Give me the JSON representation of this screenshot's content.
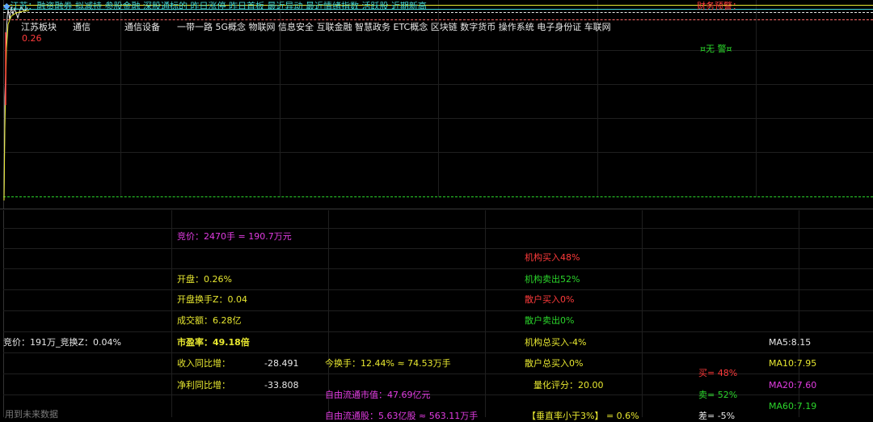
{
  "colors": {
    "cyan": "#3fd1d1",
    "red": "#ff3b3b",
    "green": "#2bd62b",
    "yellow": "#e8e830",
    "magenta": "#e23ce2",
    "white": "#e8e8e8",
    "gray": "#7a7a7a"
  },
  "chart": {
    "top_tags": "江苏：融资融券 拟减持 参股金融 深股通标的 昨日涨停 昨日首板 最近异动 最近情绪指数 活跃股 近期新高",
    "tag_prefix_icon": "diamond-icon",
    "alert_right": "财务预警：",
    "sectors": [
      "江苏板块",
      "通信",
      "通信设备",
      "一带一路 5G概念 物联网 信息安全 互联金融 智慧政务 ETC概念 区块链 数字货币 操作系统 电子身份证 车联网"
    ],
    "price_label": "0.26",
    "no_alert": "无 警"
  },
  "stats": {
    "auction": "竞价：2470手 = 190.7万元",
    "open": "开盘：0.26%",
    "open_turnover": "开盘换手Z：0.04",
    "volume": "成交额：6.28亿",
    "pe": "市盈率：49.18倍",
    "revenue_label": "收入同比增：",
    "revenue_value": "-28.491",
    "profit_label": "净利同比增：",
    "profit_value": "-33.808",
    "auction_left": "竞价：191万_竞换Z：0.04%",
    "turnover_today": "今换手：12.44%  ≈  74.53万手",
    "free_float_value": "自由流通市值：47.69亿元",
    "free_float_shares": "自由流通股：5.63亿股  ≈  563.11万手",
    "future_data": "用到未来数据",
    "inst_buy": "机构买入48%",
    "inst_sell": "机构卖出52%",
    "retail_buy": "散户买入0%",
    "retail_sell": "散户卖出0%",
    "inst_total_buy": "机构总买入-4%",
    "retail_total_buy": "散户总买入0%",
    "quant_score": "量化评分：20.00",
    "turnover_lt": "【垂直率小于3%】 = 0.6%",
    "ma5": "MA5:8.15",
    "ma10": "MA10:7.95",
    "ma20": "MA20:7.60",
    "ma60": "MA60:7.19",
    "buy_pct": "买= 48%",
    "sell_pct": "卖= 52%",
    "diff_pct": "差= -5%"
  }
}
